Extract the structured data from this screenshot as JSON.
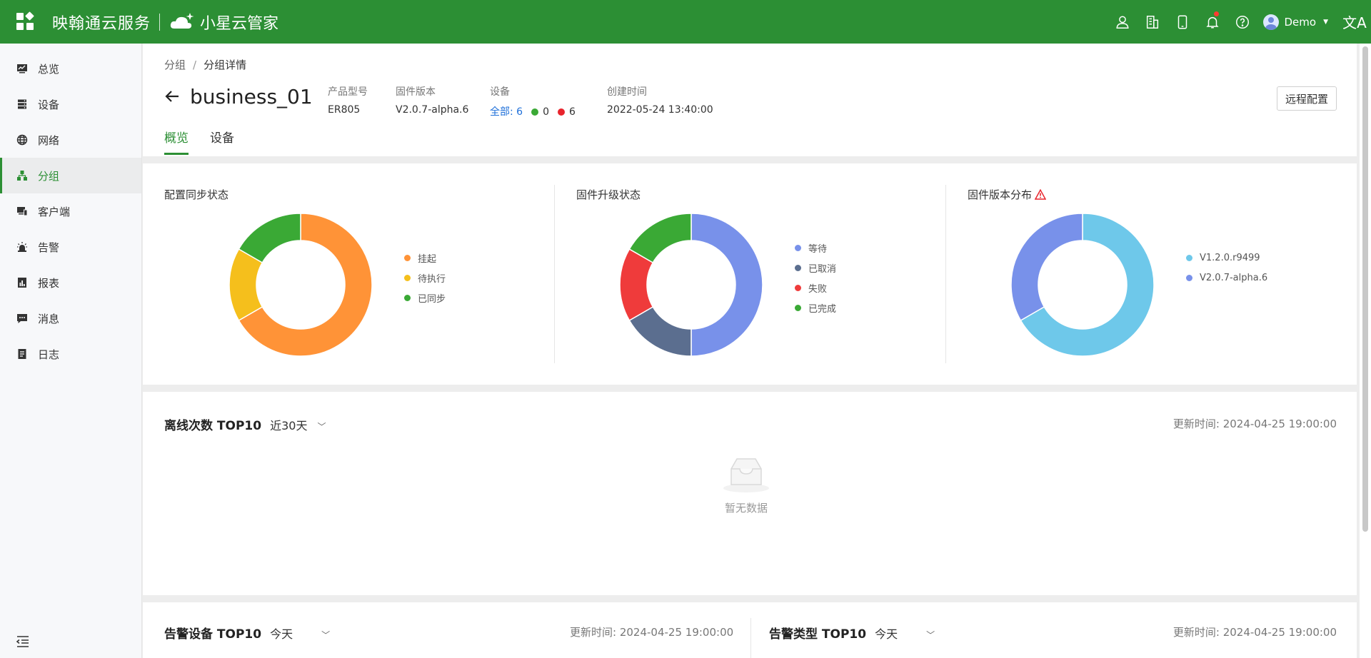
{
  "topbar": {
    "brand": "映翰通云服务",
    "product": "小星云管家",
    "user": "Demo",
    "lang_glyph": "文A"
  },
  "sidebar": {
    "items": [
      {
        "label": "总览",
        "icon": "dashboard-icon"
      },
      {
        "label": "设备",
        "icon": "devices-icon"
      },
      {
        "label": "网络",
        "icon": "network-globe-icon"
      },
      {
        "label": "分组",
        "icon": "group-icon",
        "active": true
      },
      {
        "label": "客户端",
        "icon": "client-icon"
      },
      {
        "label": "告警",
        "icon": "alarm-icon"
      },
      {
        "label": "报表",
        "icon": "report-icon"
      },
      {
        "label": "消息",
        "icon": "message-icon"
      },
      {
        "label": "日志",
        "icon": "log-icon"
      }
    ]
  },
  "breadcrumb": {
    "parent": "分组",
    "separator": "/",
    "current": "分组详情"
  },
  "group": {
    "name": "business_01",
    "model_label": "产品型号",
    "model": "ER805",
    "firmware_label": "固件版本",
    "firmware": "V2.0.7-alpha.6",
    "devices_label": "设备",
    "devices_all_label": "全部:",
    "devices_all": "6",
    "devices_online": "0",
    "devices_offline": "6",
    "created_label": "创建时间",
    "created": "2022-05-24 13:40:00"
  },
  "remote_config_label": "远程配置",
  "tabs": [
    {
      "label": "概览",
      "active": true
    },
    {
      "label": "设备",
      "active": false
    }
  ],
  "colors": {
    "brand": "#2c8f34",
    "online": "#3aa935",
    "offline": "#e8242c",
    "link": "#1e6fd9"
  },
  "chart_data": [
    {
      "type": "pie",
      "title": "配置同步状态",
      "categories": [
        "挂起",
        "待执行",
        "已同步"
      ],
      "values": [
        4,
        1,
        1
      ],
      "colors": [
        "#ff9337",
        "#f5bf1c",
        "#3aa935"
      ],
      "legend": "right"
    },
    {
      "type": "pie",
      "title": "固件升级状态",
      "categories": [
        "等待",
        "已取消",
        "失败",
        "已完成"
      ],
      "values": [
        3,
        1,
        1,
        1
      ],
      "colors": [
        "#7891ea",
        "#5b6e8f",
        "#ef3b3b",
        "#3aa935"
      ],
      "legend": "right"
    },
    {
      "type": "pie",
      "title": "固件版本分布",
      "warning": true,
      "categories": [
        "V1.2.0.r9499",
        "V2.0.7-alpha.6"
      ],
      "values": [
        2,
        1
      ],
      "colors": [
        "#6ec8ea",
        "#7891ea"
      ],
      "legend": "right"
    }
  ],
  "offline_section": {
    "title": "离线次数 TOP10",
    "range": "近30天",
    "update_label": "更新时间:",
    "update_time": "2024-04-25 19:00:00",
    "empty_text": "暂无数据"
  },
  "alarm_device_section": {
    "title": "告警设备 TOP10",
    "range": "今天",
    "update_label": "更新时间:",
    "update_time": "2024-04-25 19:00:00"
  },
  "alarm_type_section": {
    "title": "告警类型 TOP10",
    "range": "今天",
    "update_label": "更新时间:",
    "update_time": "2024-04-25 19:00:00"
  }
}
